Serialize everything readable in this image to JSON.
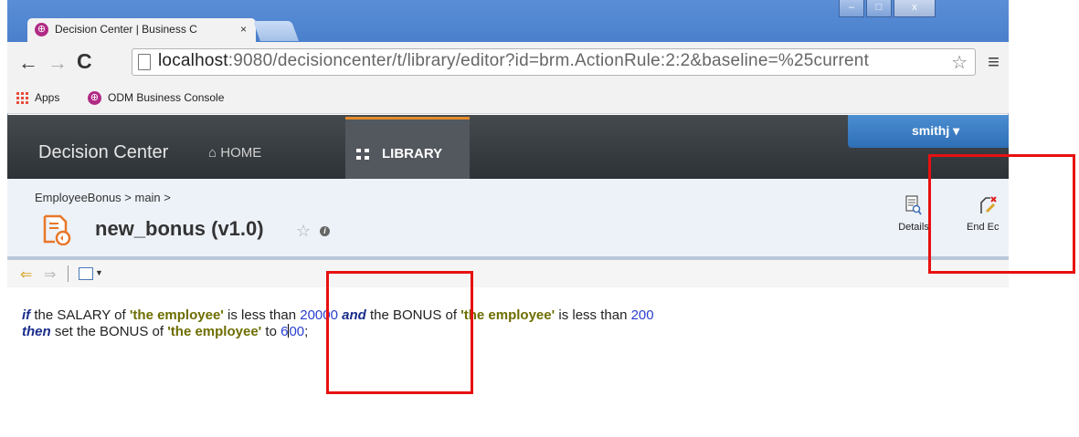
{
  "browser": {
    "tab_title": "Decision Center | Business C",
    "tab_close": "×",
    "window_controls": [
      "‒",
      "□",
      "x"
    ],
    "url_host": "localhost",
    "url_path": ":9080/decisioncenter/t/library/editor?id=brm.ActionRule:2:2&baseline=%25current",
    "bookmarks": [
      "Apps",
      "ODM Business Console"
    ]
  },
  "app_header": {
    "brand": "Decision Center",
    "nav_home": "HOME",
    "nav_library": "LIBRARY",
    "user": "smithj"
  },
  "artifact": {
    "breadcrumb": "EmployeeBonus > main >",
    "name": "new_bonus (v1.0)",
    "actions": {
      "details": "Details",
      "end_edit": "End Ec"
    }
  },
  "rule": {
    "line1": {
      "kw_if": "if",
      "t1": " the SALARY of ",
      "var1": "'the employee'",
      "t2": " is less than ",
      "num1": "20000",
      "t3": " ",
      "kw_and": "and",
      "t4": " the BONUS of ",
      "var2": "'the employee'",
      "t5": " is less than ",
      "num2": "200"
    },
    "line2": {
      "kw_then": "then",
      "t1": " set the BONUS of ",
      "var1": "'the employee'",
      "t2": " to ",
      "num_a": "6",
      "num_b": "00",
      "t3": ";"
    }
  },
  "colors": {
    "highlight": "#e81010",
    "keyword": "#1a2d8c",
    "variable": "#6d6d00",
    "number": "#2a3fd1",
    "library_tab_accent": "#e38a2c",
    "user_tab": "#2e6fb6"
  }
}
